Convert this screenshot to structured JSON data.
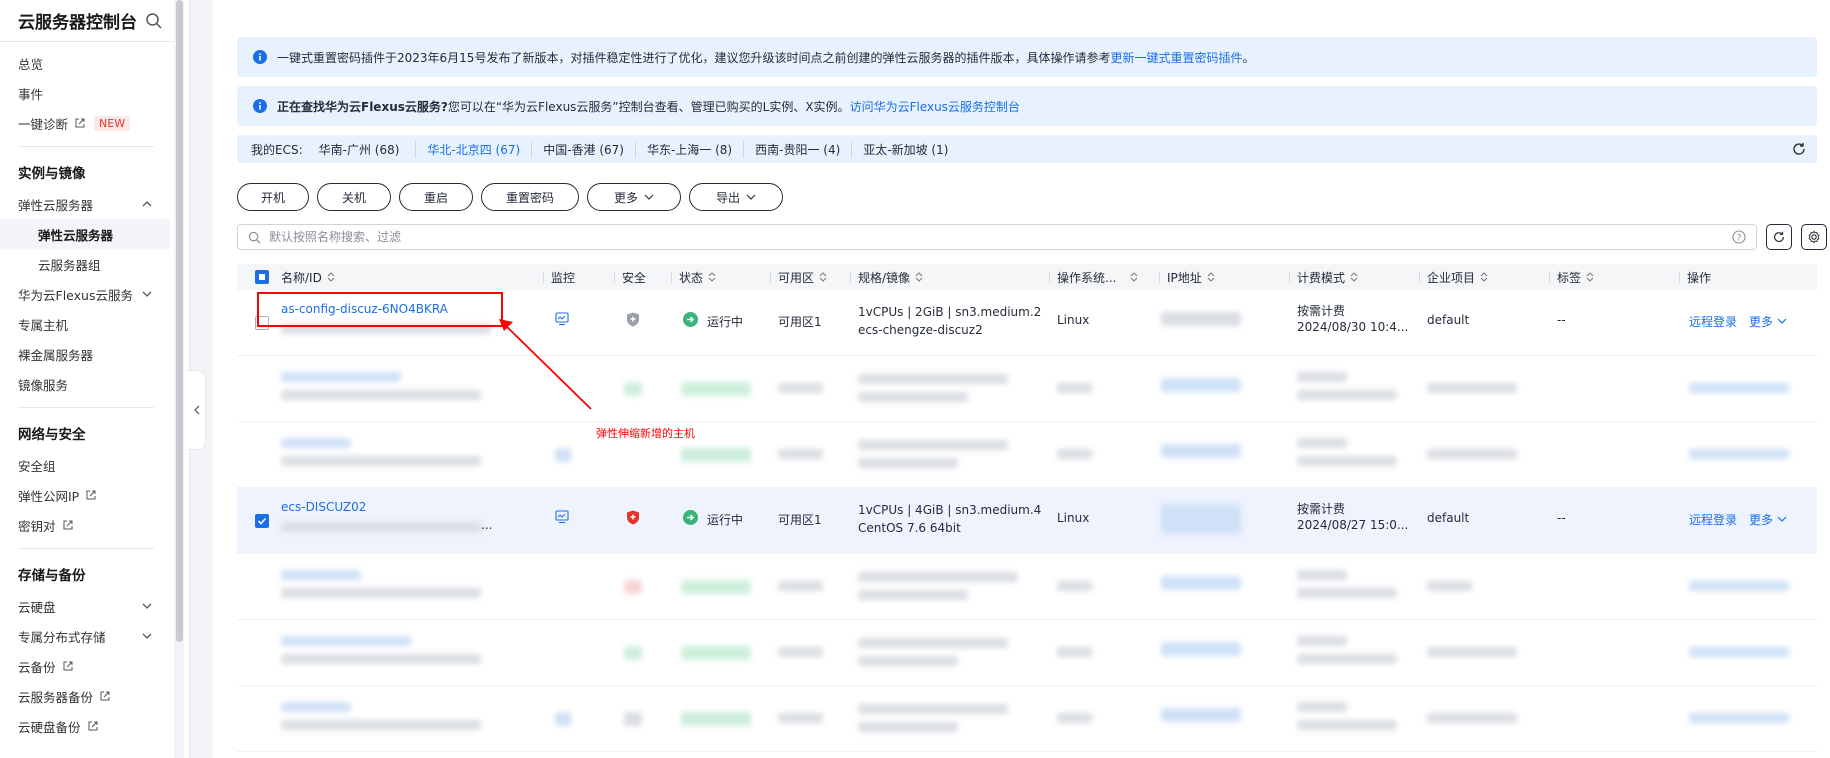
{
  "sidebar": {
    "title": "云服务器控制台",
    "items": [
      {
        "label": "总览"
      },
      {
        "label": "事件"
      },
      {
        "label": "一键诊断",
        "badge": "NEW"
      }
    ],
    "group1": "实例与镜像",
    "ecs": "弹性云服务器",
    "ecs_sub_active": "弹性云服务器",
    "ecs_sub_group": "云服务器组",
    "flexus": "华为云Flexus云服务",
    "dedicated": "专属主机",
    "bms": "裸金属服务器",
    "ims": "镜像服务",
    "group2": "网络与安全",
    "sg": "安全组",
    "eip": "弹性公网IP",
    "keypair": "密钥对",
    "group3": "存储与备份",
    "evs": "云硬盘",
    "dss": "专属分布式存储",
    "cbr": "云备份",
    "csbs": "云服务器备份",
    "vbs": "云硬盘备份"
  },
  "banner1": {
    "text": "一键式重置密码插件于2023年6月15号发布了新版本，对插件稳定性进行了优化，建议您升级该时间点之前创建的弹性云服务器的插件版本，具体操作请参考",
    "link": "更新一键式重置密码插件",
    "tail": "。"
  },
  "banner2": {
    "bold": "正在查找华为云Flexus云服务?",
    "text": " 您可以在“华为云Flexus云服务”控制台查看、管理已购买的L实例、X实例。",
    "link": "访问华为云Flexus云服务控制台"
  },
  "regions": {
    "label": "我的ECS:",
    "list": [
      "华南-广州 (68)",
      "华北-北京四 (67)",
      "中国-香港 (67)",
      "华东-上海一 (8)",
      "西南-贵阳一 (4)",
      "亚太-新加坡 (1)"
    ]
  },
  "toolbar": {
    "start": "开机",
    "stop": "关机",
    "restart": "重启",
    "reset_pwd": "重置密码",
    "more": "更多",
    "export": "导出"
  },
  "search": {
    "placeholder": "默认按照名称搜索、过滤"
  },
  "table": {
    "headers": [
      "名称/ID",
      "监控",
      "安全",
      "状态",
      "可用区",
      "规格/镜像",
      "操作系统...",
      "IP地址",
      "计费模式",
      "企业项目",
      "标签",
      "操作"
    ],
    "row1": {
      "name": "as-config-discuz-6NO4BKRA",
      "status": "运行中",
      "az": "可用区1",
      "spec": "1vCPUs | 2GiB | sn3.medium.2",
      "image": "ecs-chengze-discuz2",
      "os": "Linux",
      "billing": "按需计费",
      "billing_time": "2024/08/30 10:4...",
      "project": "default",
      "tags": "--",
      "op_login": "远程登录",
      "op_more": "更多"
    },
    "row4": {
      "name": "ecs-DISCUZ02",
      "id_tail": "...",
      "status": "运行中",
      "az": "可用区1",
      "spec": "1vCPUs | 4GiB | sn3.medium.4",
      "image": "CentOS 7.6 64bit",
      "os": "Linux",
      "billing": "按需计费",
      "billing_time": "2024/08/27 15:0...",
      "project": "default",
      "tags": "--",
      "op_login": "远程登录",
      "op_more": "更多"
    }
  },
  "annotation": {
    "text": "弹性伸缩新增的主机",
    "color": "#ff0000"
  },
  "colors": {
    "accent": "#1a6fe8",
    "running": "#3bb37a",
    "banner_bg": "#e8f2ff",
    "shield_red": "#e0362c",
    "shield_gray": "#9aa0ab"
  }
}
